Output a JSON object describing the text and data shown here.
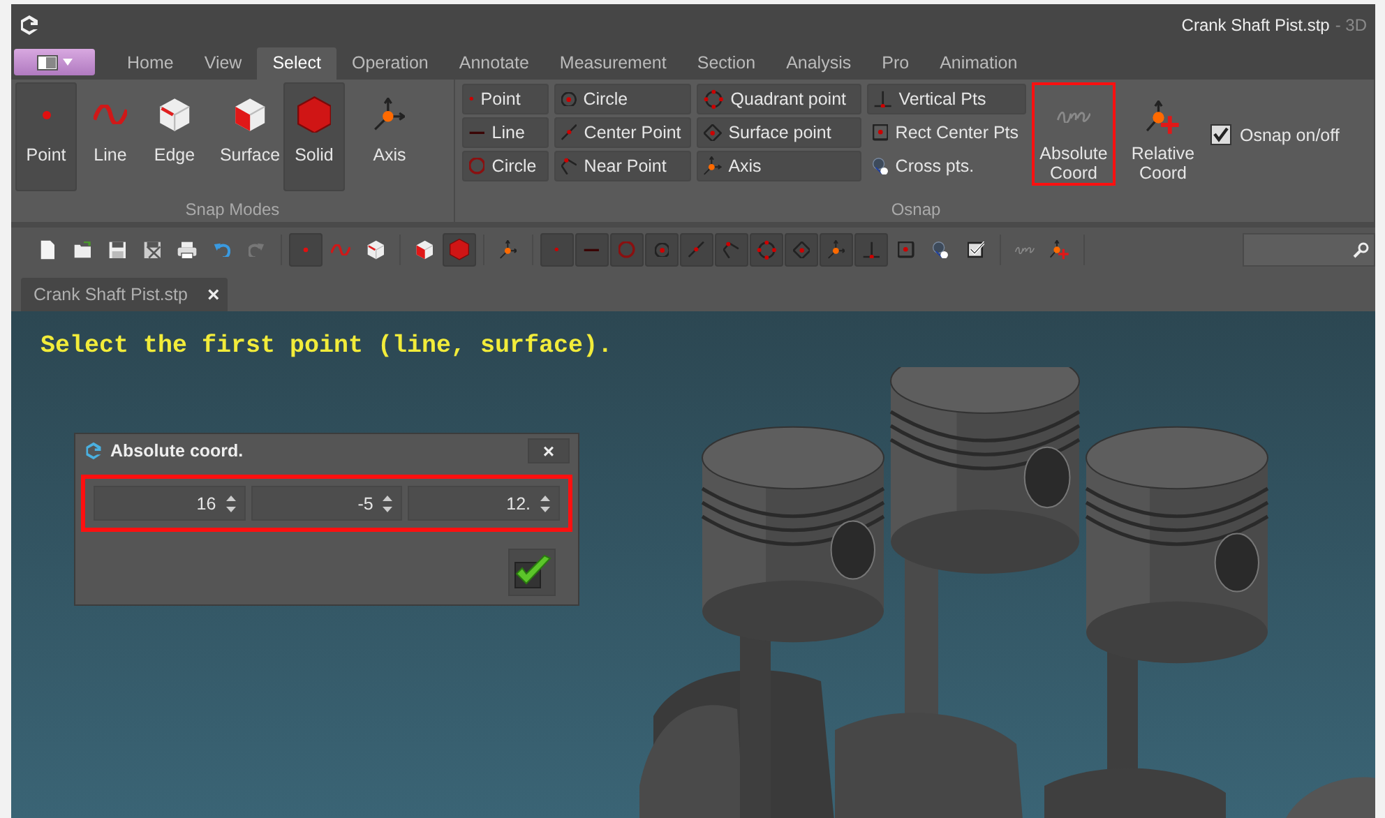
{
  "window": {
    "title": "Crank Shaft Pist.stp",
    "title_suffix": "- 3D"
  },
  "ribbon_tabs": [
    {
      "label": "Home",
      "selected": false
    },
    {
      "label": "View",
      "selected": false
    },
    {
      "label": "Select",
      "selected": true
    },
    {
      "label": "Operation",
      "selected": false
    },
    {
      "label": "Annotate",
      "selected": false
    },
    {
      "label": "Measurement",
      "selected": false
    },
    {
      "label": "Section",
      "selected": false
    },
    {
      "label": "Analysis",
      "selected": false
    },
    {
      "label": "Pro",
      "selected": false
    },
    {
      "label": "Animation",
      "selected": false
    }
  ],
  "snap_modes": {
    "label": "Snap Modes",
    "items": [
      {
        "kind": "point",
        "label": "Point",
        "selected": true
      },
      {
        "kind": "wave",
        "label": "Line",
        "selected": false
      },
      {
        "kind": "edge",
        "label": "Edge",
        "selected": false
      },
      {
        "kind": "surface",
        "label": "Surface",
        "selected": false
      },
      {
        "kind": "solid",
        "label": "Solid",
        "selected": true
      },
      {
        "kind": "axis",
        "label": "Axis",
        "selected": false
      }
    ]
  },
  "osnap": {
    "label": "Osnap",
    "items": [
      {
        "kind": "dot",
        "label": "Point",
        "on": true
      },
      {
        "kind": "center-circle",
        "label": "Circle",
        "on": true
      },
      {
        "kind": "quadrant",
        "label": "Quadrant point",
        "on": true
      },
      {
        "kind": "vertical",
        "label": "Vertical Pts",
        "on": true
      },
      {
        "kind": "dash",
        "label": "Line",
        "on": true
      },
      {
        "kind": "center-point",
        "label": "Center Point",
        "on": true
      },
      {
        "kind": "surface-point",
        "label": "Surface point",
        "on": true
      },
      {
        "kind": "rect-center",
        "label": "Rect Center Pts",
        "on": false
      },
      {
        "kind": "ring",
        "label": "Circle",
        "on": true
      },
      {
        "kind": "near-point",
        "label": "Near Point",
        "on": true
      },
      {
        "kind": "small-axis",
        "label": "Axis",
        "on": true
      },
      {
        "kind": "cross",
        "label": "Cross pts.",
        "on": false
      }
    ],
    "large_buttons": [
      {
        "kind": "abs-coord",
        "label": "Absolute Coord",
        "highlighted": true
      },
      {
        "kind": "rel-coord",
        "label": "Relative Coord",
        "highlighted": false
      }
    ],
    "toggle": {
      "label": "Osnap on/off",
      "checked": true
    }
  },
  "toolbar": [
    {
      "kind": "new",
      "on": false
    },
    {
      "kind": "open",
      "on": false
    },
    {
      "kind": "save",
      "on": false
    },
    {
      "kind": "save-as",
      "on": false
    },
    {
      "kind": "print",
      "on": false
    },
    {
      "kind": "undo",
      "on": false
    },
    {
      "kind": "redo",
      "on": false
    },
    {
      "kind": "point",
      "on": true
    },
    {
      "kind": "wave",
      "on": false
    },
    {
      "kind": "edge",
      "on": false
    },
    {
      "kind": "surface",
      "on": false
    },
    {
      "kind": "solid",
      "on": true
    },
    {
      "kind": "axis",
      "on": false
    },
    {
      "kind": "dot",
      "on": true
    },
    {
      "kind": "dash",
      "on": true
    },
    {
      "kind": "ring",
      "on": true
    },
    {
      "kind": "center-circle",
      "on": true
    },
    {
      "kind": "center-point",
      "on": true
    },
    {
      "kind": "near-point",
      "on": true
    },
    {
      "kind": "quadrant",
      "on": true
    },
    {
      "kind": "surface-point",
      "on": true
    },
    {
      "kind": "small-axis",
      "on": true
    },
    {
      "kind": "vertical",
      "on": true
    },
    {
      "kind": "rect-center",
      "on": false
    },
    {
      "kind": "cross",
      "on": false
    },
    {
      "kind": "check",
      "on": false
    },
    {
      "kind": "abs-coord",
      "on": false
    },
    {
      "kind": "rel-coord",
      "on": false
    }
  ],
  "doc_tabs": [
    {
      "label": "Crank Shaft Pist.stp",
      "close": "×",
      "selected": true
    }
  ],
  "viewport": {
    "prompt": "Select the first point (line, surface).",
    "dialog": {
      "title": "Absolute coord.",
      "close": "×",
      "highlighted": true,
      "fields": [
        {
          "value": "16"
        },
        {
          "value": "-5"
        },
        {
          "value": "12."
        }
      ]
    }
  }
}
